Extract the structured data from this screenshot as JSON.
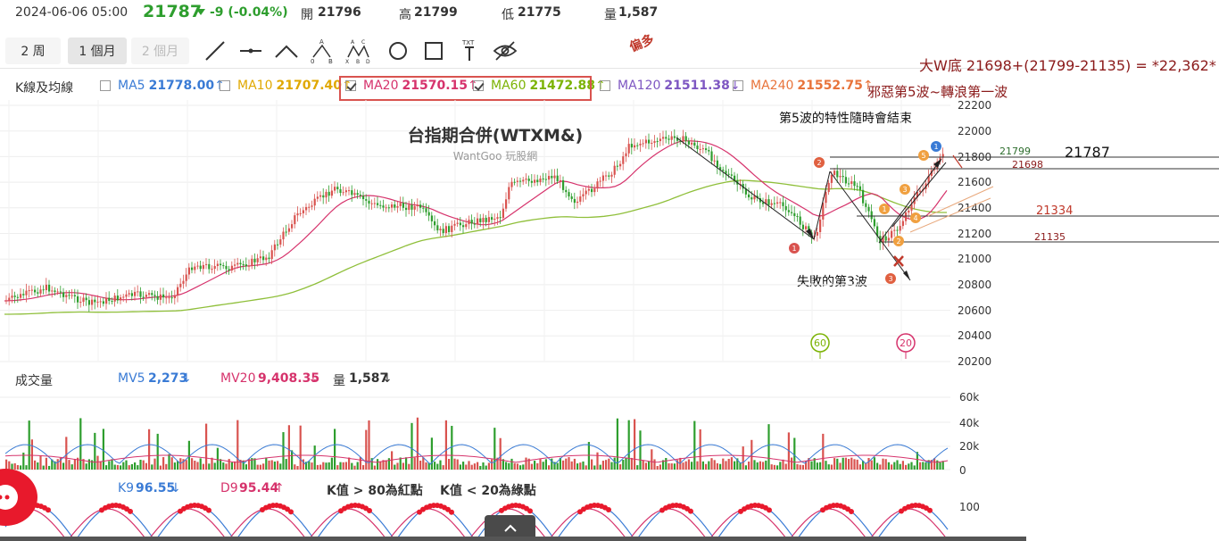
{
  "quote": {
    "datetime": "2024-06-06 05:00",
    "price": "21787",
    "change": "-9 (-0.04%)",
    "open_label": "開",
    "open": "21796",
    "high_label": "高",
    "high": "21799",
    "low_label": "低",
    "low": "21775",
    "volume_label": "量",
    "volume": "1,587"
  },
  "periods": [
    {
      "label": "2 周",
      "state": "normal"
    },
    {
      "label": "1 個月",
      "state": "active"
    },
    {
      "label": "2 個月",
      "state": "disabled"
    }
  ],
  "tools": [
    "line-tool-icon",
    "horizontal-line-tool-icon",
    "angle-tool-icon",
    "abc-pattern-tool-icon",
    "xabcd-pattern-tool-icon",
    "circle-tool-icon",
    "rectangle-tool-icon",
    "text-tool-icon",
    "hide-eye-icon"
  ],
  "tool_glyphs": {
    "abc": [
      "A",
      "0",
      "B"
    ],
    "xabcd": [
      "A",
      "C",
      "X",
      "B",
      "D"
    ],
    "text": "TXT"
  },
  "ma_legend": {
    "title": "K線及均線",
    "items": [
      {
        "label": "MA5",
        "value": "21778.00",
        "arrow": "↑",
        "color": "#3a7bd5",
        "checked": false
      },
      {
        "label": "MA10",
        "value": "21707.40",
        "arrow": "↑",
        "color": "#e0a800",
        "checked": false
      },
      {
        "label": "MA20",
        "value": "21570.15",
        "arrow": "↑",
        "color": "#d6336c",
        "checked": true
      },
      {
        "label": "MA60",
        "value": "21472.88",
        "arrow": "↑",
        "color": "#7cb305",
        "checked": true
      },
      {
        "label": "MA120",
        "value": "21511.38",
        "arrow": "↓",
        "color": "#7e57c2",
        "checked": false
      },
      {
        "label": "MA240",
        "value": "21552.75",
        "arrow": "↑",
        "color": "#e8743b",
        "checked": false
      }
    ]
  },
  "chart": {
    "title": "台指期合併(WTXM&)",
    "watermark": "WantGoo 玩股網",
    "y_axis": [
      "22200",
      "22000",
      "21800",
      "21600",
      "21400",
      "21200",
      "21000",
      "20800",
      "20600",
      "20400",
      "20200"
    ],
    "ma_badges": [
      "60",
      "20"
    ]
  },
  "annotations": {
    "bias": "偏多",
    "w_bottom": "大W底 21698+(21799-21135) = *22,362*",
    "evil_wave": "邪惡第5波~轉浪第一波",
    "wave5_note": "第5波的特性隨時會結束",
    "failed_wave3": "失敗的第3波",
    "lvl_21799": "21799",
    "lvl_21787": "21787",
    "lvl_21698": "21698",
    "lvl_21334": "21334",
    "lvl_21135": "21135",
    "wave_marks": [
      "1",
      "2",
      "3",
      "1",
      "2",
      "3",
      "4",
      "5",
      "1"
    ]
  },
  "volume": {
    "title": "成交量",
    "mv5_label": "MV5",
    "mv5": "2,273",
    "mv5_arrow": "↓",
    "mv20_label": "MV20",
    "mv20": "9,408.35",
    "mv20_arrow": "↓",
    "vol_label": "量",
    "vol": "1,587",
    "vol_arrow": "↓",
    "y_axis": [
      "60k",
      "40k",
      "20k",
      "0"
    ]
  },
  "kd": {
    "k_label": "K9",
    "k": "96.55",
    "k_arrow": "↓",
    "d_label": "D9",
    "d": "95.44",
    "d_arrow": "↑",
    "note1": "K值 > 80為紅點",
    "note2": "K值 < 20為綠點",
    "y_axis": [
      "100"
    ]
  },
  "colors": {
    "up": "#d9534f",
    "down": "#2e9e2e",
    "ma20": "#d6336c",
    "ma60": "#8fbf3a",
    "annot_red": "#c0392b",
    "dark_red": "#8b1a1a"
  }
}
